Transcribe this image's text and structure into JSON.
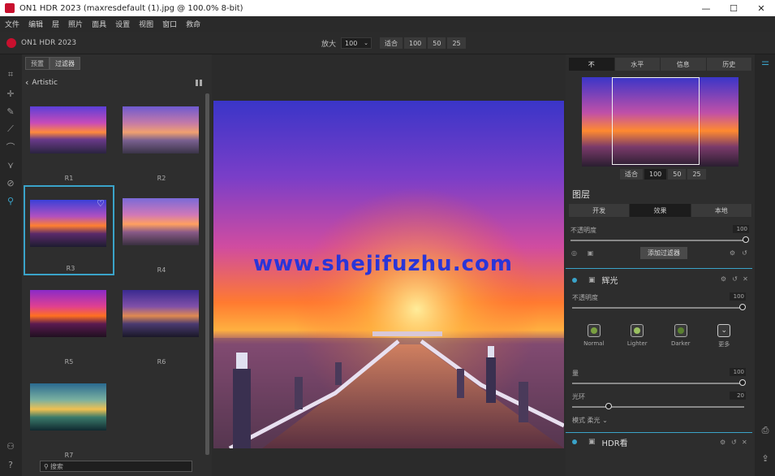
{
  "window": {
    "title": "ON1 HDR 2023 (maxresdefault (1).jpg @ 100.0% 8-bit)",
    "min": "—",
    "max": "☐",
    "close": "✕"
  },
  "menu": [
    "文件",
    "编辑",
    "层",
    "照片",
    "面具",
    "设置",
    "视图",
    "窗口",
    "救命"
  ],
  "toolbar": {
    "brand": "ON1 HDR 2023",
    "zoom_label": "放大",
    "zoom_value": "100",
    "zoom_buttons": [
      "适合",
      "100",
      "50",
      "25"
    ]
  },
  "browser": {
    "tabs": [
      "预置",
      "过滤器"
    ],
    "back_label": "Artistic",
    "thumbs": [
      "R1",
      "R2",
      "R3",
      "R4",
      "R5",
      "R6",
      "R7"
    ],
    "search_placeholder": "搜索"
  },
  "watermark": "www.shejifuzhu.com",
  "right": {
    "tabs": [
      "不",
      "水平",
      "信息",
      "历史"
    ],
    "nav_zoom": [
      "适合",
      "100",
      "50",
      "25"
    ],
    "layer_title": "图层",
    "seg": [
      "开发",
      "效果",
      "本地"
    ],
    "opacity_label": "不透明度",
    "opacity_value": "100",
    "add_filter": "添加过滤器",
    "filter1": {
      "name": "辉光",
      "opacity_label": "不透明度",
      "opacity_value": "100",
      "presets": [
        "Normal",
        "Lighter",
        "Darker",
        "更多"
      ],
      "amount_label": "量",
      "amount_value": "100",
      "halo_label": "光环",
      "halo_value": "20",
      "mode": "模式 柔光 ⌄"
    },
    "filter2": {
      "name": "HDR看"
    }
  }
}
